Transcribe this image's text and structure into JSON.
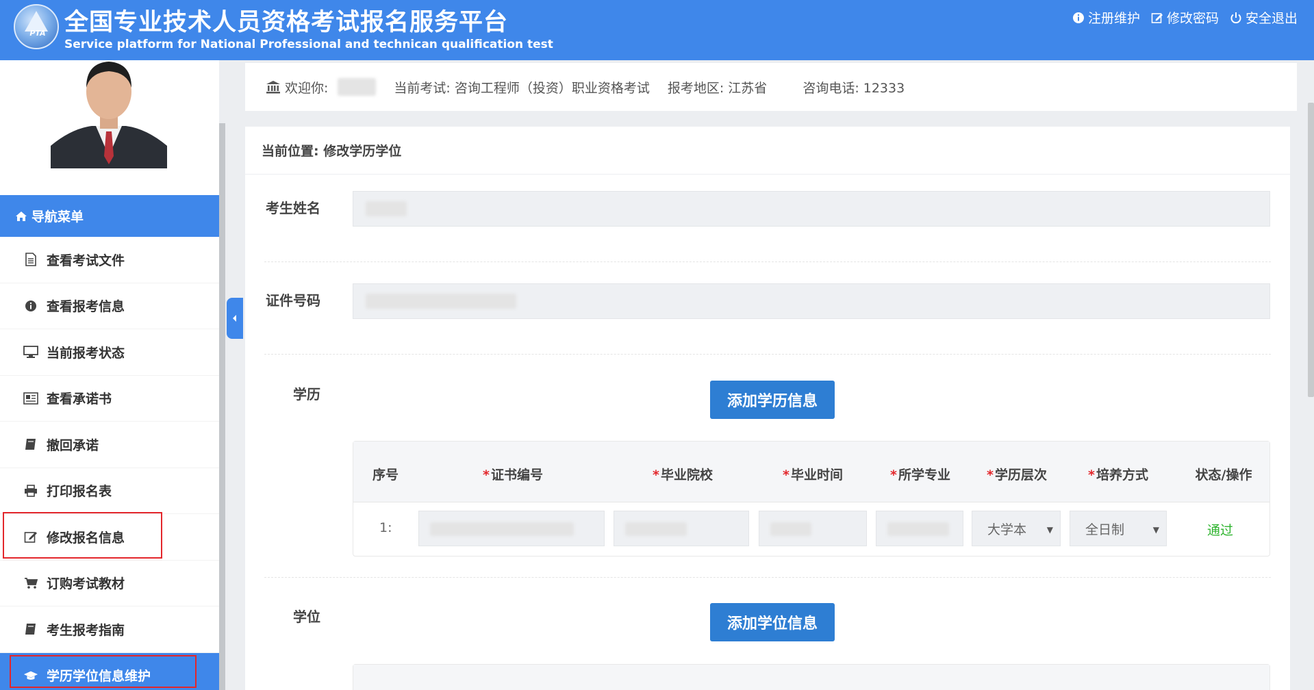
{
  "header": {
    "logo_text": "PTA",
    "title_cn": "全国专业技术人员资格考试报名服务平台",
    "title_en": "Service platform for National Professional and technican qualification test",
    "links": [
      {
        "label": "注册维护",
        "icon": "info-icon"
      },
      {
        "label": "修改密码",
        "icon": "edit-icon"
      },
      {
        "label": "安全退出",
        "icon": "power-icon"
      }
    ]
  },
  "sidebar": {
    "nav_header": "导航菜单",
    "items": [
      {
        "label": "查看考试文件",
        "icon": "document-icon"
      },
      {
        "label": "查看报考信息",
        "icon": "info-icon"
      },
      {
        "label": "当前报考状态",
        "icon": "monitor-icon"
      },
      {
        "label": "查看承诺书",
        "icon": "newspaper-icon"
      },
      {
        "label": "撤回承诺",
        "icon": "book-icon"
      },
      {
        "label": "打印报名表",
        "icon": "print-icon"
      },
      {
        "label": "修改报名信息",
        "icon": "edit-icon"
      },
      {
        "label": "订购考试教材",
        "icon": "cart-icon"
      },
      {
        "label": "考生报考指南",
        "icon": "book-icon"
      },
      {
        "label": "学历学位信息维护",
        "icon": "graduation-cap-icon"
      }
    ]
  },
  "info_bar": {
    "welcome_label": "欢迎你:",
    "exam": "当前考试: 咨询工程师（投资）职业资格考试",
    "region": "报考地区: 江苏省",
    "phone": "咨询电话:  12333"
  },
  "main": {
    "breadcrumb": "当前位置: 修改学历学位",
    "name_label": "考生姓名",
    "id_label": "证件号码",
    "education_label": "学历",
    "add_education_button": "添加学历信息",
    "degree_label": "学位",
    "add_degree_button": "添加学位信息",
    "table": {
      "columns": [
        "序号",
        "证书编号",
        "毕业院校",
        "毕业时间",
        "所学专业",
        "学历层次",
        "培养方式",
        "状态/操作"
      ],
      "rows": [
        {
          "index": "1:",
          "level": "大学本",
          "mode": "全日制",
          "status": "通过"
        }
      ]
    }
  },
  "colors": {
    "brand_blue": "#3f87ea",
    "button_blue": "#2e7ed3",
    "highlight_red": "#e3262b",
    "status_green": "#2db32d"
  }
}
